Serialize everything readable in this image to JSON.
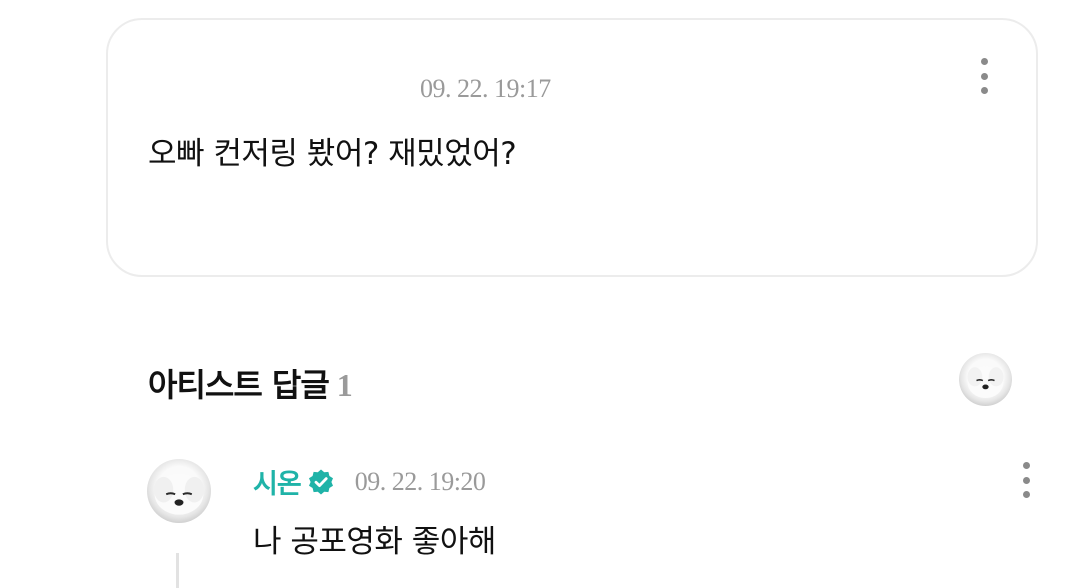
{
  "post": {
    "timestamp": "09. 22. 19:17",
    "text": "오빠 컨저링 봤어? 재밌었어?",
    "more_icon": "more-vertical-icon"
  },
  "artist_replies": {
    "title": "아티스트 답글",
    "count": "1",
    "avatar_icon": "dog-avatar"
  },
  "reply": {
    "author": "시온",
    "verified_icon": "verified-badge-icon",
    "timestamp": "09. 22. 19:20",
    "text": "나 공포영화 좋아해",
    "more_icon": "more-vertical-icon",
    "avatar_icon": "dog-avatar"
  },
  "colors": {
    "accent": "#1fb3a8",
    "muted": "#9a9a9a",
    "border": "#ececec"
  }
}
